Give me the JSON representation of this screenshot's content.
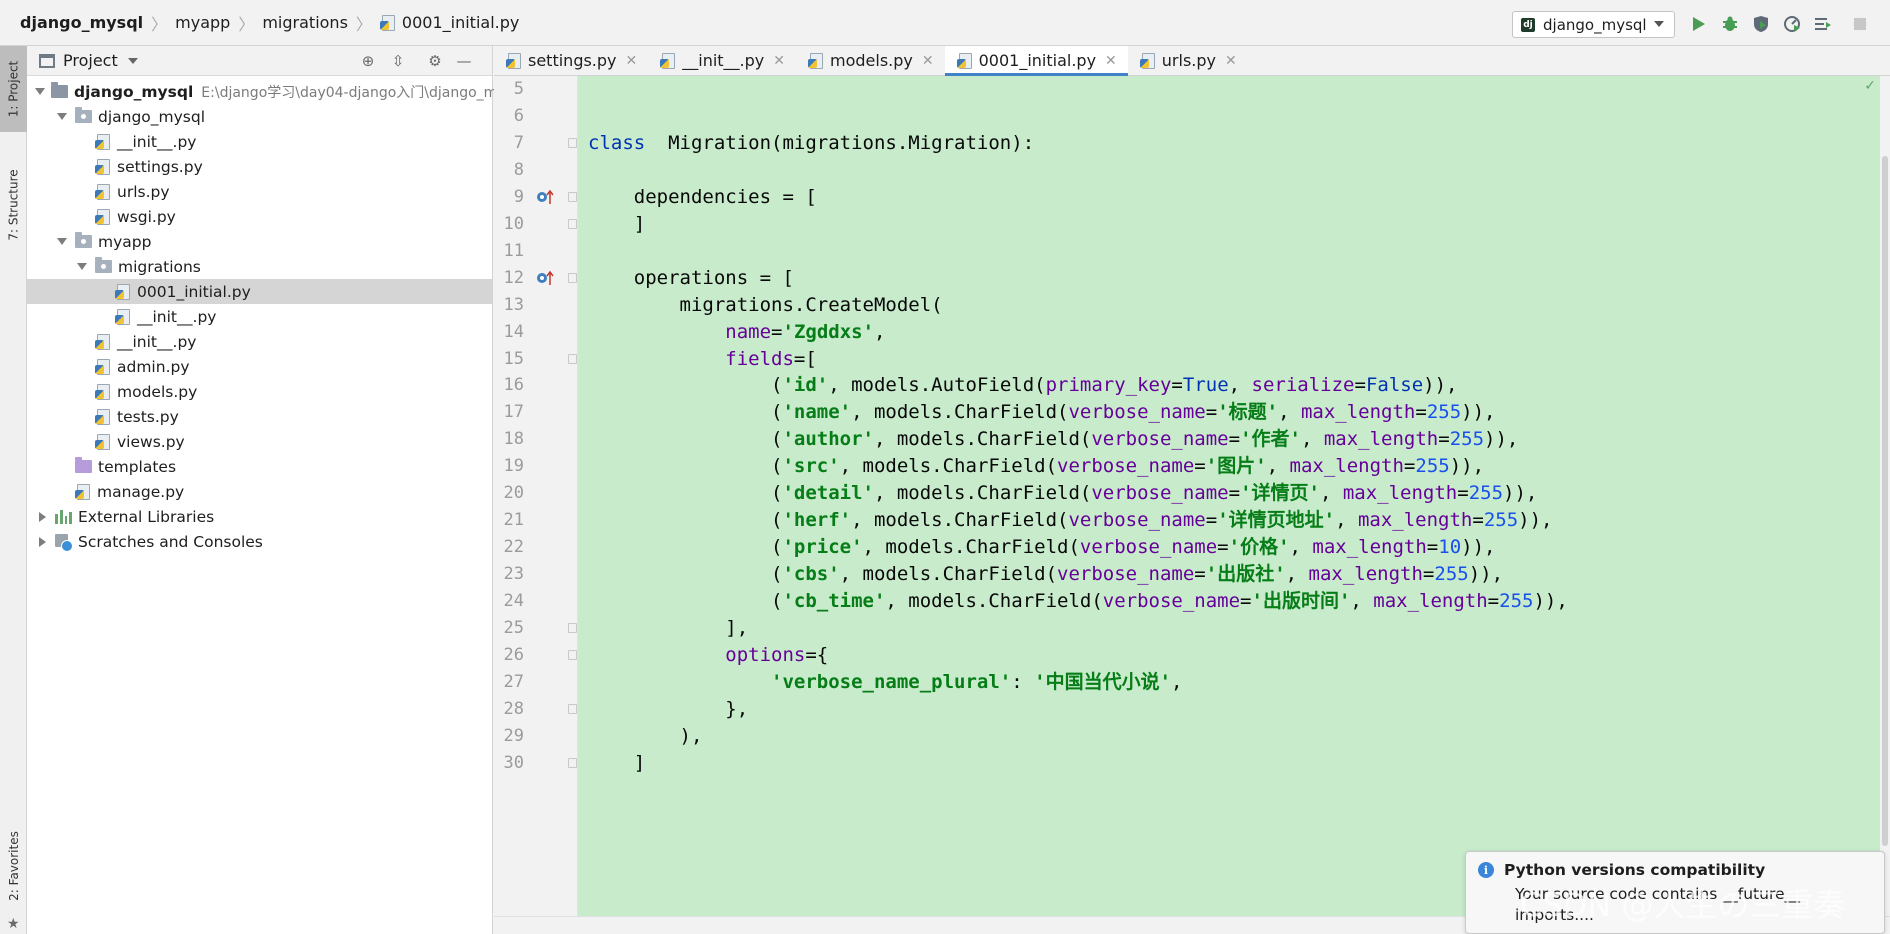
{
  "breadcrumbs": [
    "django_mysql",
    "myapp",
    "migrations",
    "0001_initial.py"
  ],
  "run_config": {
    "label": "django_mysql",
    "icon": "django-icon"
  },
  "toolbar_icons": [
    "run-icon",
    "debug-icon",
    "coverage-icon",
    "profile-icon",
    "build-icon",
    "stop-icon"
  ],
  "tool_stripe": {
    "project": "1: Project",
    "structure": "7: Structure",
    "favorites": "2: Favorites"
  },
  "project_panel": {
    "title": "Project",
    "tree": [
      {
        "label": "django_mysql",
        "path": "E:\\django学习\\day04-django入门\\django_m",
        "depth": 0,
        "arrow": "down",
        "icon": "folder-dark",
        "bold": true
      },
      {
        "label": "django_mysql",
        "depth": 1,
        "arrow": "down",
        "icon": "folder-pkg"
      },
      {
        "label": "__init__.py",
        "depth": 2,
        "arrow": "none",
        "icon": "py"
      },
      {
        "label": "settings.py",
        "depth": 2,
        "arrow": "none",
        "icon": "py"
      },
      {
        "label": "urls.py",
        "depth": 2,
        "arrow": "none",
        "icon": "py"
      },
      {
        "label": "wsgi.py",
        "depth": 2,
        "arrow": "none",
        "icon": "py"
      },
      {
        "label": "myapp",
        "depth": 1,
        "arrow": "down",
        "icon": "folder-pkg"
      },
      {
        "label": "migrations",
        "depth": 2,
        "arrow": "down",
        "icon": "folder-pkg"
      },
      {
        "label": "0001_initial.py",
        "depth": 3,
        "arrow": "none",
        "icon": "py",
        "selected": true
      },
      {
        "label": "__init__.py",
        "depth": 3,
        "arrow": "none",
        "icon": "py"
      },
      {
        "label": "__init__.py",
        "depth": 2,
        "arrow": "none",
        "icon": "py"
      },
      {
        "label": "admin.py",
        "depth": 2,
        "arrow": "none",
        "icon": "py"
      },
      {
        "label": "models.py",
        "depth": 2,
        "arrow": "none",
        "icon": "py"
      },
      {
        "label": "tests.py",
        "depth": 2,
        "arrow": "none",
        "icon": "py"
      },
      {
        "label": "views.py",
        "depth": 2,
        "arrow": "none",
        "icon": "py"
      },
      {
        "label": "templates",
        "depth": 1,
        "arrow": "none",
        "icon": "folder-purple"
      },
      {
        "label": "manage.py",
        "depth": 1,
        "arrow": "none",
        "icon": "py"
      },
      {
        "label": "External Libraries",
        "depth": 0,
        "arrow": "right",
        "icon": "library"
      },
      {
        "label": "Scratches and Consoles",
        "depth": 0,
        "arrow": "right",
        "icon": "scratch"
      }
    ]
  },
  "editor_tabs": [
    {
      "label": "settings.py",
      "active": false
    },
    {
      "label": "__init__.py",
      "active": false
    },
    {
      "label": "models.py",
      "active": false
    },
    {
      "label": "0001_initial.py",
      "active": true
    },
    {
      "label": "urls.py",
      "active": false
    }
  ],
  "code_lines": [
    {
      "n": 5,
      "marker": false,
      "fold": false,
      "tokens": []
    },
    {
      "n": 6,
      "marker": false,
      "fold": false,
      "tokens": []
    },
    {
      "n": 7,
      "marker": false,
      "fold": true,
      "tokens": [
        [
          "kw",
          "class"
        ],
        [
          "",
          "  Migration(migrations.Migration):"
        ]
      ]
    },
    {
      "n": 8,
      "marker": false,
      "fold": false,
      "tokens": []
    },
    {
      "n": 9,
      "marker": true,
      "fold": true,
      "tokens": [
        [
          "",
          "    dependencies = ["
        ]
      ]
    },
    {
      "n": 10,
      "marker": false,
      "fold": true,
      "tokens": [
        [
          "",
          "    ]"
        ]
      ]
    },
    {
      "n": 11,
      "marker": false,
      "fold": false,
      "tokens": []
    },
    {
      "n": 12,
      "marker": true,
      "fold": true,
      "tokens": [
        [
          "",
          "    operations = ["
        ]
      ]
    },
    {
      "n": 13,
      "marker": false,
      "fold": false,
      "tokens": [
        [
          "",
          "        migrations.CreateModel("
        ]
      ]
    },
    {
      "n": 14,
      "marker": false,
      "fold": false,
      "tokens": [
        [
          "",
          "            "
        ],
        [
          "kwarg",
          "name"
        ],
        [
          "",
          "="
        ],
        [
          "str",
          "'Zgddxs'"
        ],
        [
          "",
          ","
        ]
      ]
    },
    {
      "n": 15,
      "marker": false,
      "fold": true,
      "tokens": [
        [
          "",
          "            "
        ],
        [
          "kwarg",
          "fields"
        ],
        [
          "",
          "=["
        ]
      ]
    },
    {
      "n": 16,
      "marker": false,
      "fold": false,
      "tokens": [
        [
          "",
          "                ("
        ],
        [
          "str",
          "'id'"
        ],
        [
          "",
          ", models.AutoField("
        ],
        [
          "kwarg",
          "primary_key"
        ],
        [
          "",
          "="
        ],
        [
          "bool",
          "True"
        ],
        [
          "",
          ", "
        ],
        [
          "kwarg",
          "serialize"
        ],
        [
          "",
          "="
        ],
        [
          "bool",
          "False"
        ],
        [
          "",
          ")),"
        ]
      ]
    },
    {
      "n": 17,
      "marker": false,
      "fold": false,
      "tokens": [
        [
          "",
          "                ("
        ],
        [
          "str",
          "'name'"
        ],
        [
          "",
          ", models.CharField("
        ],
        [
          "kwarg",
          "verbose_name"
        ],
        [
          "",
          "="
        ],
        [
          "str",
          "'标题'"
        ],
        [
          "",
          ", "
        ],
        [
          "kwarg",
          "max_length"
        ],
        [
          "",
          "="
        ],
        [
          "num",
          "255"
        ],
        [
          "",
          ")),"
        ]
      ]
    },
    {
      "n": 18,
      "marker": false,
      "fold": false,
      "tokens": [
        [
          "",
          "                ("
        ],
        [
          "str",
          "'author'"
        ],
        [
          "",
          ", models.CharField("
        ],
        [
          "kwarg",
          "verbose_name"
        ],
        [
          "",
          "="
        ],
        [
          "str",
          "'作者'"
        ],
        [
          "",
          ", "
        ],
        [
          "kwarg",
          "max_length"
        ],
        [
          "",
          "="
        ],
        [
          "num",
          "255"
        ],
        [
          "",
          ")),"
        ]
      ]
    },
    {
      "n": 19,
      "marker": false,
      "fold": false,
      "tokens": [
        [
          "",
          "                ("
        ],
        [
          "str",
          "'src'"
        ],
        [
          "",
          ", models.CharField("
        ],
        [
          "kwarg",
          "verbose_name"
        ],
        [
          "",
          "="
        ],
        [
          "str",
          "'图片'"
        ],
        [
          "",
          ", "
        ],
        [
          "kwarg",
          "max_length"
        ],
        [
          "",
          "="
        ],
        [
          "num",
          "255"
        ],
        [
          "",
          ")),"
        ]
      ]
    },
    {
      "n": 20,
      "marker": false,
      "fold": false,
      "tokens": [
        [
          "",
          "                ("
        ],
        [
          "str",
          "'detail'"
        ],
        [
          "",
          ", models.CharField("
        ],
        [
          "kwarg",
          "verbose_name"
        ],
        [
          "",
          "="
        ],
        [
          "str",
          "'详情页'"
        ],
        [
          "",
          ", "
        ],
        [
          "kwarg",
          "max_length"
        ],
        [
          "",
          "="
        ],
        [
          "num",
          "255"
        ],
        [
          "",
          ")),"
        ]
      ]
    },
    {
      "n": 21,
      "marker": false,
      "fold": false,
      "tokens": [
        [
          "",
          "                ("
        ],
        [
          "str",
          "'herf'"
        ],
        [
          "",
          ", models.CharField("
        ],
        [
          "kwarg",
          "verbose_name"
        ],
        [
          "",
          "="
        ],
        [
          "str",
          "'详情页地址'"
        ],
        [
          "",
          ", "
        ],
        [
          "kwarg",
          "max_length"
        ],
        [
          "",
          "="
        ],
        [
          "num",
          "255"
        ],
        [
          "",
          ")),"
        ]
      ]
    },
    {
      "n": 22,
      "marker": false,
      "fold": false,
      "tokens": [
        [
          "",
          "                ("
        ],
        [
          "str",
          "'price'"
        ],
        [
          "",
          ", models.CharField("
        ],
        [
          "kwarg",
          "verbose_name"
        ],
        [
          "",
          "="
        ],
        [
          "str",
          "'价格'"
        ],
        [
          "",
          ", "
        ],
        [
          "kwarg",
          "max_length"
        ],
        [
          "",
          "="
        ],
        [
          "num",
          "10"
        ],
        [
          "",
          ")),"
        ]
      ]
    },
    {
      "n": 23,
      "marker": false,
      "fold": false,
      "tokens": [
        [
          "",
          "                ("
        ],
        [
          "str",
          "'cbs'"
        ],
        [
          "",
          ", models.CharField("
        ],
        [
          "kwarg",
          "verbose_name"
        ],
        [
          "",
          "="
        ],
        [
          "str",
          "'出版社'"
        ],
        [
          "",
          ", "
        ],
        [
          "kwarg",
          "max_length"
        ],
        [
          "",
          "="
        ],
        [
          "num",
          "255"
        ],
        [
          "",
          ")),"
        ]
      ]
    },
    {
      "n": 24,
      "marker": false,
      "fold": false,
      "tokens": [
        [
          "",
          "                ("
        ],
        [
          "str",
          "'cb_time'"
        ],
        [
          "",
          ", models.CharField("
        ],
        [
          "kwarg",
          "verbose_name"
        ],
        [
          "",
          "="
        ],
        [
          "str",
          "'出版时间'"
        ],
        [
          "",
          ", "
        ],
        [
          "kwarg",
          "max_length"
        ],
        [
          "",
          "="
        ],
        [
          "num",
          "255"
        ],
        [
          "",
          ")),"
        ]
      ]
    },
    {
      "n": 25,
      "marker": false,
      "fold": true,
      "tokens": [
        [
          "",
          "            ],"
        ]
      ]
    },
    {
      "n": 26,
      "marker": false,
      "fold": true,
      "tokens": [
        [
          "",
          "            "
        ],
        [
          "kwarg",
          "options"
        ],
        [
          "",
          "={"
        ]
      ]
    },
    {
      "n": 27,
      "marker": false,
      "fold": false,
      "tokens": [
        [
          "",
          "                "
        ],
        [
          "str",
          "'verbose_name_plural'"
        ],
        [
          "",
          ": "
        ],
        [
          "str",
          "'中国当代小说'"
        ],
        [
          "",
          ","
        ]
      ]
    },
    {
      "n": 28,
      "marker": false,
      "fold": true,
      "tokens": [
        [
          "",
          "            },"
        ]
      ]
    },
    {
      "n": 29,
      "marker": false,
      "fold": false,
      "tokens": [
        [
          "",
          "        ),"
        ]
      ]
    },
    {
      "n": 30,
      "marker": false,
      "fold": true,
      "tokens": [
        [
          "",
          "    ]"
        ]
      ]
    }
  ],
  "notification": {
    "title": "Python versions compatibility",
    "body_line1": "Your source code contains __future__",
    "body_line2": "imports...."
  },
  "watermark": "CSDN @人生の三重奏",
  "colors": {
    "editor_bg": "#c8ebcc",
    "keyword": "#0033b3",
    "string": "#067d17",
    "kwarg": "#660099",
    "number": "#1750eb",
    "accent": "#4083c9"
  }
}
